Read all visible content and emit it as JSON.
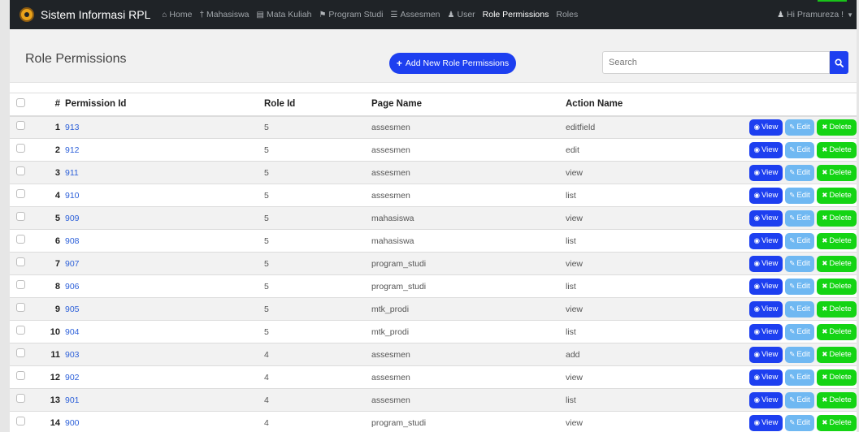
{
  "app": {
    "title": "Sistem Informasi RPL",
    "colors": {
      "navbar": "#1f2327",
      "primary": "#1d3ff0",
      "edit": "#6fb8f2",
      "delete": "#14d414",
      "link": "#2b5fd9"
    }
  },
  "nav": {
    "items": [
      {
        "label": "Home",
        "icon": "home-icon",
        "active": false
      },
      {
        "label": "Mahasiswa",
        "icon": "user-tie-icon",
        "active": false
      },
      {
        "label": "Mata Kuliah",
        "icon": "book-icon",
        "active": false
      },
      {
        "label": "Program Studi",
        "icon": "bookmark-icon",
        "active": false
      },
      {
        "label": "Assesmen",
        "icon": "list-icon",
        "active": false
      },
      {
        "label": "User",
        "icon": "users-icon",
        "active": false
      },
      {
        "label": "Role Permissions",
        "icon": "",
        "active": true
      },
      {
        "label": "Roles",
        "icon": "",
        "active": false
      }
    ],
    "user_greeting": "Hi Pramureza !"
  },
  "page": {
    "title": "Role Permissions",
    "add_button_label": "Add New Role Permissions",
    "search_placeholder": "Search"
  },
  "table": {
    "columns": [
      "#",
      "Permission Id",
      "Role Id",
      "Page Name",
      "Action Name"
    ],
    "action_labels": {
      "view": "View",
      "edit": "Edit",
      "delete": "Delete"
    },
    "rows": [
      {
        "num": "1",
        "permission_id": "913",
        "role_id": "5",
        "page_name": "assesmen",
        "action_name": "editfield"
      },
      {
        "num": "2",
        "permission_id": "912",
        "role_id": "5",
        "page_name": "assesmen",
        "action_name": "edit"
      },
      {
        "num": "3",
        "permission_id": "911",
        "role_id": "5",
        "page_name": "assesmen",
        "action_name": "view"
      },
      {
        "num": "4",
        "permission_id": "910",
        "role_id": "5",
        "page_name": "assesmen",
        "action_name": "list"
      },
      {
        "num": "5",
        "permission_id": "909",
        "role_id": "5",
        "page_name": "mahasiswa",
        "action_name": "view"
      },
      {
        "num": "6",
        "permission_id": "908",
        "role_id": "5",
        "page_name": "mahasiswa",
        "action_name": "list"
      },
      {
        "num": "7",
        "permission_id": "907",
        "role_id": "5",
        "page_name": "program_studi",
        "action_name": "view"
      },
      {
        "num": "8",
        "permission_id": "906",
        "role_id": "5",
        "page_name": "program_studi",
        "action_name": "list"
      },
      {
        "num": "9",
        "permission_id": "905",
        "role_id": "5",
        "page_name": "mtk_prodi",
        "action_name": "view"
      },
      {
        "num": "10",
        "permission_id": "904",
        "role_id": "5",
        "page_name": "mtk_prodi",
        "action_name": "list"
      },
      {
        "num": "11",
        "permission_id": "903",
        "role_id": "4",
        "page_name": "assesmen",
        "action_name": "add"
      },
      {
        "num": "12",
        "permission_id": "902",
        "role_id": "4",
        "page_name": "assesmen",
        "action_name": "view"
      },
      {
        "num": "13",
        "permission_id": "901",
        "role_id": "4",
        "page_name": "assesmen",
        "action_name": "list"
      },
      {
        "num": "14",
        "permission_id": "900",
        "role_id": "4",
        "page_name": "program_studi",
        "action_name": "view"
      }
    ]
  }
}
